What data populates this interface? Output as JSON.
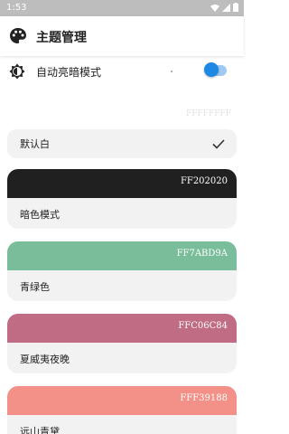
{
  "status": {
    "time": "1:53"
  },
  "app_bar": {
    "title": "主题管理",
    "icon": "palette-icon"
  },
  "auto_dark": {
    "label": "自动亮暗模式",
    "enabled": true,
    "icon": "brightness-icon",
    "accent": "#1e88e5"
  },
  "faint_text": "FFFFFFFF",
  "default_theme": {
    "label": "默认白",
    "selected": true,
    "icon": "check-icon"
  },
  "themes": [
    {
      "hex": "FF202020",
      "name": "暗色模式",
      "color": "#202020"
    },
    {
      "hex": "FF7ABD9A",
      "name": "青绿色",
      "color": "#7abd9a"
    },
    {
      "hex": "FFC06C84",
      "name": "夏威夷夜晚",
      "color": "#c06c84"
    },
    {
      "hex": "FFF39188",
      "name": "远山青黛",
      "color": "#f39188"
    }
  ]
}
